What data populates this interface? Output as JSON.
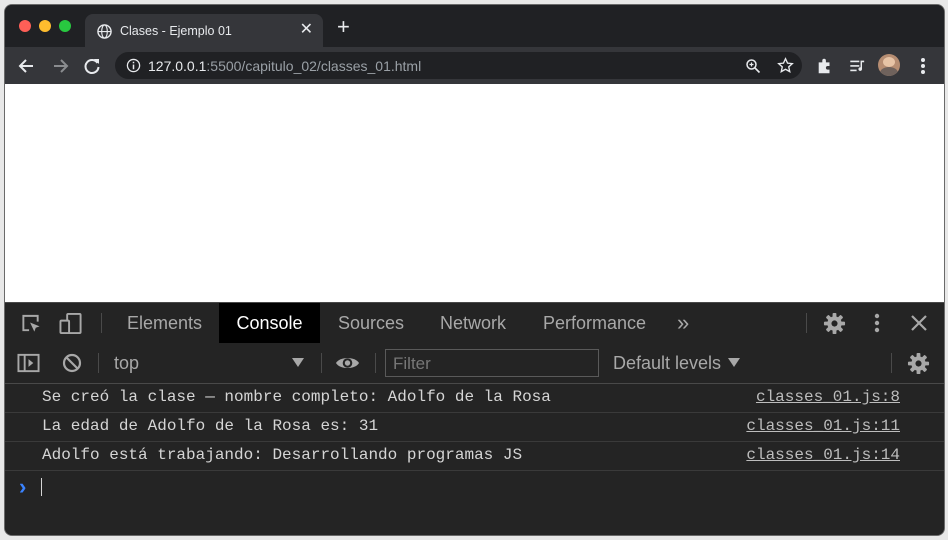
{
  "browser": {
    "tab_title": "Clases - Ejemplo 01",
    "tab_close": "✕",
    "new_tab": "+",
    "url_host": "127.0.0.1",
    "url_rest": ":5500/capitulo_02/classes_01.html"
  },
  "devtools": {
    "tabs": [
      "Elements",
      "Console",
      "Sources",
      "Network",
      "Performance"
    ],
    "active_tab": "Console",
    "more_tabs": "»",
    "context": "top",
    "filter_placeholder": "Filter",
    "levels": "Default levels"
  },
  "console": {
    "messages": [
      {
        "text": "Se creó la clase — nombre completo: Adolfo de la Rosa",
        "source": "classes_01.js:8"
      },
      {
        "text": "La edad de Adolfo de la Rosa es: 31",
        "source": "classes_01.js:11"
      },
      {
        "text": "Adolfo está trabajando: Desarrollando programas JS",
        "source": "classes_01.js:14"
      }
    ],
    "prompt": "›"
  },
  "colors": {
    "accent": "#3a83ff",
    "traffic_red": "#fe5f57",
    "traffic_yellow": "#febc2e",
    "traffic_green": "#28c840"
  }
}
